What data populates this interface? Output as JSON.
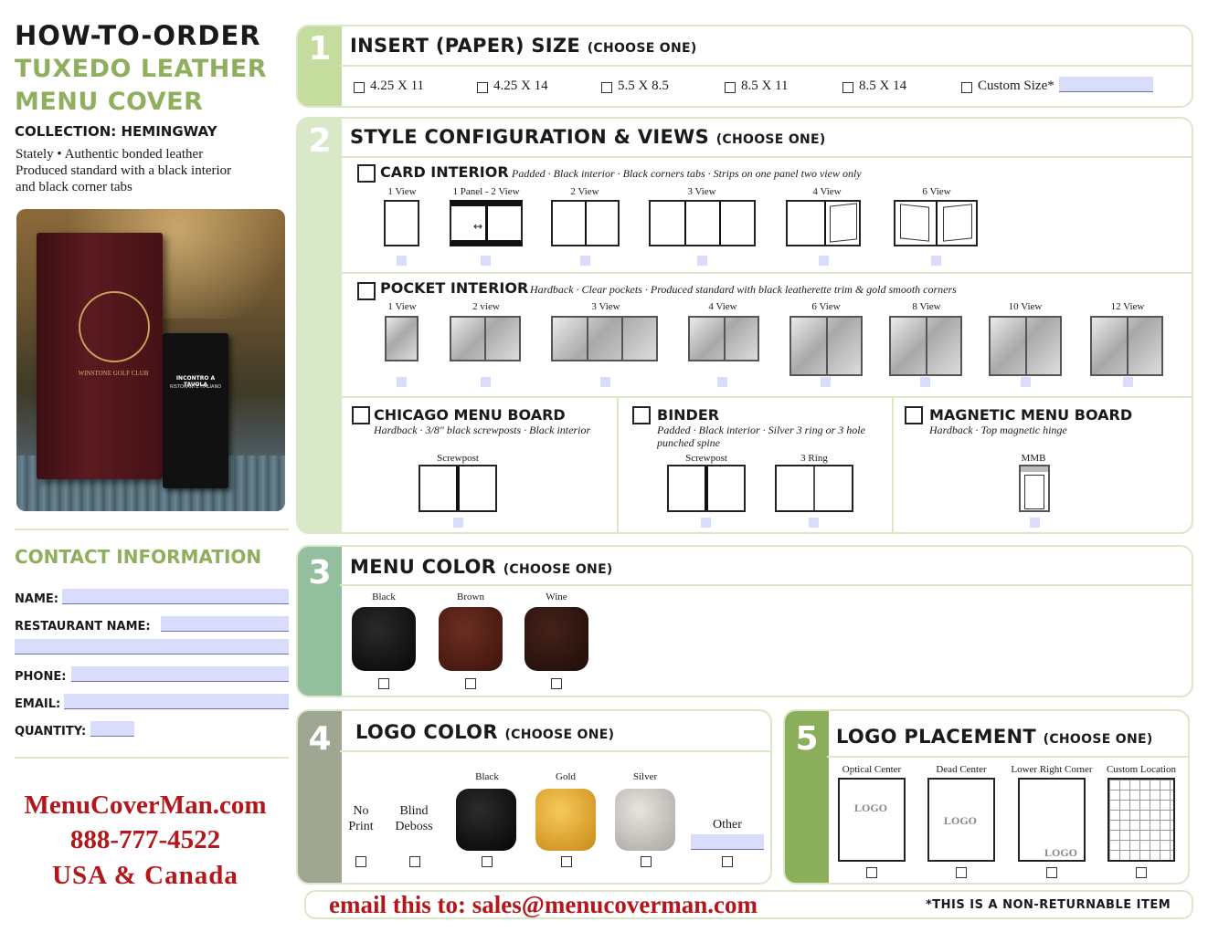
{
  "header": {
    "line1": "HOW-TO-ORDER",
    "line2": "TUXEDO LEATHER",
    "line3": "MENU COVER",
    "collection": "COLLECTION: HEMINGWAY",
    "desc1": "Stately • Authentic bonded leather",
    "desc2": "Produced standard with a black interior",
    "desc3": "and black corner tabs"
  },
  "photo": {
    "cover_big_text": "WINSTONE GOLF CLUB",
    "cover_small_text1": "INCONTRO A TAVOLA",
    "cover_small_text2": "RISTORANTE ITALIANO"
  },
  "contact": {
    "title": "CONTACT INFORMATION",
    "name_label": "NAME:",
    "restaurant_label": "RESTAURANT NAME:",
    "phone_label": "PHONE:",
    "email_label": "EMAIL:",
    "quantity_label": "QUANTITY:"
  },
  "brand": {
    "site": "MenuCoverMan.com",
    "phone": "888-777-4522",
    "region": "USA & Canada"
  },
  "s1": {
    "num": "1",
    "title": "INSERT (PAPER) SIZE",
    "choose": "(CHOOSE ONE)",
    "options": [
      "4.25 X 11",
      "4.25 X 14",
      "5.5 X 8.5",
      "8.5 X 11",
      "8.5 X 14",
      "Custom Size*"
    ]
  },
  "s2": {
    "num": "2",
    "title": "STYLE CONFIGURATION & VIEWS",
    "choose": "(CHOOSE ONE)",
    "card": {
      "title": "CARD INTERIOR",
      "note": "Padded · Black interior · Black corners tabs · Strips on one panel two view only",
      "views": [
        "1 View",
        "1 Panel - 2 View",
        "2 View",
        "3 View",
        "4 View",
        "6 View"
      ]
    },
    "pocket": {
      "title": "POCKET INTERIOR",
      "note": "Hardback · Clear pockets · Produced standard with black leatherette trim & gold smooth corners",
      "views": [
        "1 View",
        "2 view",
        "3 View",
        "4 View",
        "6 View",
        "8 View",
        "10 View",
        "12 View"
      ]
    },
    "chicago": {
      "title": "CHICAGO MENU BOARD",
      "note": "Hardback · 3/8\" black screwposts · Black interior",
      "views": [
        "Screwpost"
      ]
    },
    "binder": {
      "title": "BINDER",
      "note1": "Padded · Black interior · Silver 3 ring or 3 hole",
      "note2": "punched spine",
      "views": [
        "Screwpost",
        "3 Ring"
      ]
    },
    "magnetic": {
      "title": "MAGNETIC MENU BOARD",
      "note": "Hardback · Top magnetic hinge",
      "views": [
        "MMB"
      ]
    }
  },
  "s3": {
    "num": "3",
    "title": "MENU COLOR",
    "choose": "(CHOOSE ONE)",
    "colors": [
      {
        "label": "Black",
        "hex": "#0d0d0d"
      },
      {
        "label": "Brown",
        "hex": "#4a1c12"
      },
      {
        "label": "Wine",
        "hex": "#2a130e"
      }
    ]
  },
  "s4": {
    "num": "4",
    "title": "LOGO COLOR",
    "choose": "(CHOOSE ONE)",
    "no_print_1": "No",
    "no_print_2": "Print",
    "blind_1": "Blind",
    "blind_2": "Deboss",
    "colors": [
      {
        "label": "Black",
        "hex": "#0a0a0a"
      },
      {
        "label": "Gold",
        "hex": "#e3aa2c"
      },
      {
        "label": "Silver",
        "hex": "#c9c7c2"
      }
    ],
    "other": "Other"
  },
  "s5": {
    "num": "5",
    "title": "LOGO PLACEMENT",
    "choose": "(CHOOSE ONE)",
    "options": [
      "Optical Center",
      "Dead Center",
      "Lower Right Corner",
      "Custom Location"
    ],
    "logo_word": "LOGO"
  },
  "footer": {
    "email_line": "email this to: sales@menucoverman.com",
    "notice": "*THIS IS A NON-RETURNABLE ITEM"
  },
  "colors": {
    "green_light": "#c5dc9f",
    "green_mid": "#94bf9e",
    "green_dark": "#8aae5a",
    "gray_tab": "#9fa792",
    "brand_red": "#b3171b"
  }
}
